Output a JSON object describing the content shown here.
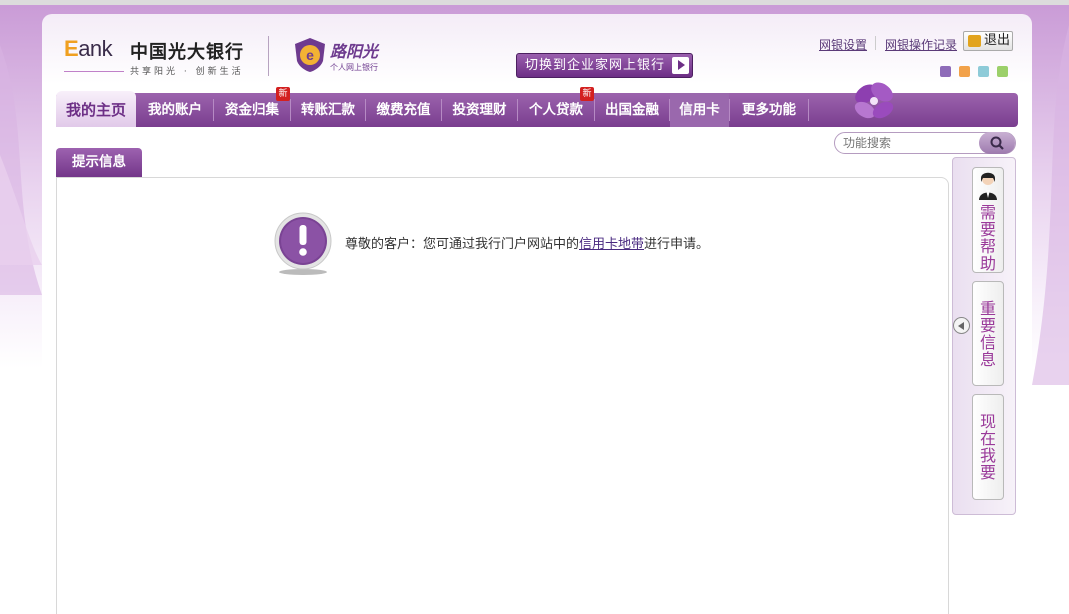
{
  "header": {
    "logo_prefix": "E",
    "logo_word": "ank",
    "bank_name": "中国光大银行",
    "slogan": "共享阳光 · 创新生活",
    "brand_title": "路阳光",
    "brand_sub": "个人网上银行",
    "enterprise_button": "切换到企业家网上银行",
    "links": {
      "settings": "网银设置",
      "history": "网银操作记录"
    },
    "logout": "退出",
    "theme_colors": [
      "#8e6bb8",
      "#f2a24a",
      "#8ecbd8",
      "#9cd06a"
    ]
  },
  "nav": {
    "home": "我的主页",
    "items": [
      {
        "label": "我的账户",
        "new": false
      },
      {
        "label": "资金归集",
        "new": true
      },
      {
        "label": "转账汇款",
        "new": false
      },
      {
        "label": "缴费充值",
        "new": false
      },
      {
        "label": "投资理财",
        "new": false
      },
      {
        "label": "个人贷款",
        "new": true
      },
      {
        "label": "出国金融",
        "new": false
      },
      {
        "label": "信用卡",
        "new": false,
        "active": true
      },
      {
        "label": "更多功能",
        "new": false
      }
    ],
    "new_badge": "新"
  },
  "search": {
    "placeholder": "功能搜索"
  },
  "content": {
    "tab": "提示信息",
    "message_before": "尊敬的客户：您可通过我行门户网站中的",
    "message_link": "信用卡地带",
    "message_after": "进行申请。"
  },
  "side": {
    "help": "需要帮助",
    "important": "重要信息",
    "now": "现在我要"
  },
  "colors": {
    "brand_purple": "#7a3e8f",
    "accent_orange": "#f0a020",
    "badge_red": "#d32020"
  }
}
